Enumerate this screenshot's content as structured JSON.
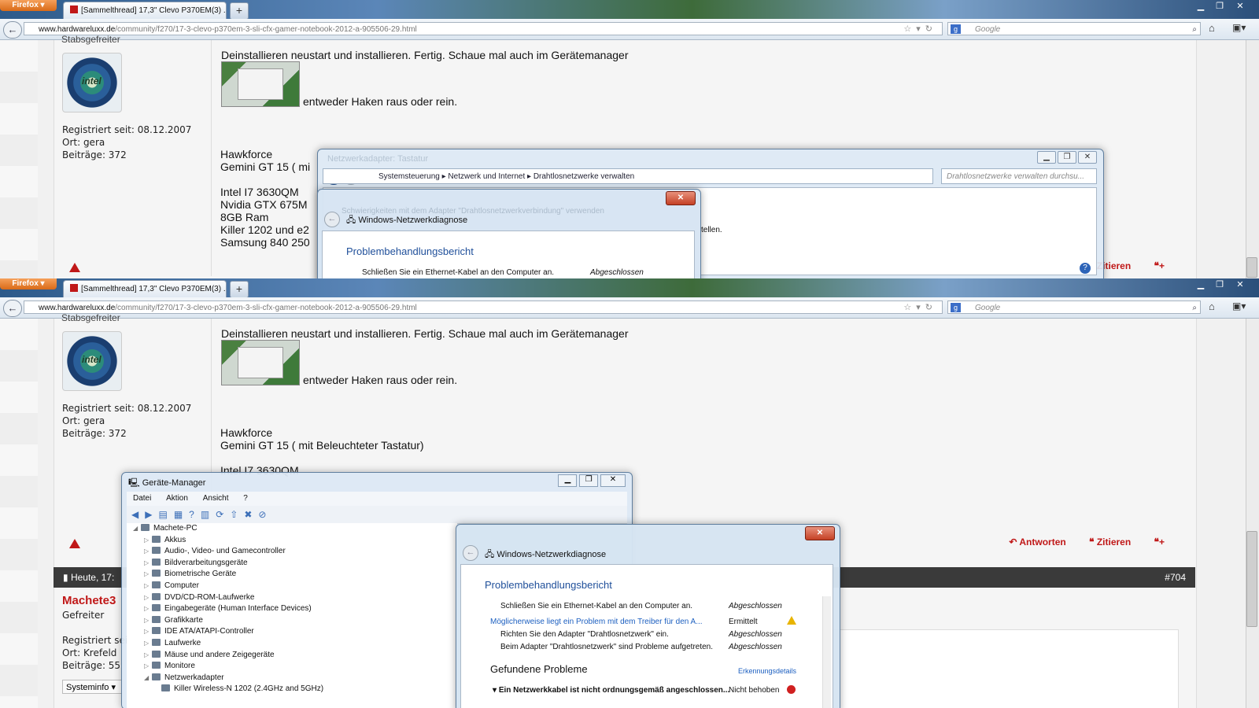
{
  "browser": {
    "menu_button": "Firefox",
    "tab_title": "[Sammelthread] 17,3\" Clevo P370EM(3) ...",
    "newtab": "+",
    "url_domain": "www.hardwareluxx.de",
    "url_path": "/community/f270/17-3-clevo-p370em-3-sli-cfx-gamer-notebook-2012-a-905506-29.html",
    "search_placeholder": "Google"
  },
  "post1": {
    "rank": "Stabsgefreiter",
    "avatar_text": "intel",
    "registered": "Registriert seit: 08.12.2007",
    "location": "Ort: gera",
    "posts": "Beiträge: 372",
    "text_line1": "Deinstallieren neustart und installieren. Fertig. Schaue mal auch im Gerätemanager",
    "text_line2": "entweder Haken raus oder rein.",
    "sig_name": "Hawkforce",
    "sig_laptop_short": "Gemini GT 15 ( mi",
    "sig_laptop": "Gemini GT 15 ( mit Beleuchteter Tastatur)",
    "sig_cpu": "Intel I7 3630QM",
    "sig_gpu": "Nvidia GTX 675M",
    "sig_ram": "8GB Ram",
    "sig_wifi": "Killer 1202 und e2",
    "sig_ssd": "Samsung 840 250",
    "sig_ssd_full": "Samsung 840 250",
    "action_reply": "Antworten",
    "action_quote": "Zitieren"
  },
  "explorer": {
    "crumb1": "Systemsteuerung",
    "crumb2": "Netzwerk und Internet",
    "crumb3": "Drahtlosnetzwerke verwalten",
    "search": "Drahtlosnetzwerke verwalten durchsu...",
    "faded_title": "Netzwerkadapter: Tastatur",
    "faded_line": "Schwierigkeiten mit dem Adapter \"Drahtlosnetzwerkverbindung\" verwenden",
    "partial_text": "tellen."
  },
  "diagnostic": {
    "title": "Windows-Netzwerkdiagnose",
    "report_heading": "Problembehandlungsbericht",
    "rows": [
      {
        "text": "Schließen Sie ein Ethernet-Kabel an den Computer an.",
        "status": "Abgeschlossen"
      },
      {
        "text": "Möglicherweise liegt ein Problem mit dem Treiber für den A...",
        "status": "Ermittelt"
      },
      {
        "text": "Richten Sie den Adapter \"Drahtlosnetzwerk\" ein.",
        "status": "Abgeschlossen"
      },
      {
        "text": "Beim Adapter \"Drahtlosnetzwerk\" sind Probleme aufgetreten.",
        "status": "Abgeschlossen"
      }
    ],
    "found_heading": "Gefundene Probleme",
    "details_link": "Erkennungsdetails",
    "found_row": "Ein Netzwerkkabel ist nicht ordnungsgemäß angeschlossen...",
    "found_status": "Nicht behoben"
  },
  "devmgr": {
    "title": "Geräte-Manager",
    "menu": [
      "Datei",
      "Aktion",
      "Ansicht",
      "?"
    ],
    "root": "Machete-PC",
    "items": [
      "Akkus",
      "Audio-, Video- und Gamecontroller",
      "Bildverarbeitungsgeräte",
      "Biometrische Geräte",
      "Computer",
      "DVD/CD-ROM-Laufwerke",
      "Eingabegeräte (Human Interface Devices)",
      "Grafikkarte",
      "IDE ATA/ATAPI-Controller",
      "Laufwerke",
      "Mäuse und andere Zeigegeräte",
      "Monitore",
      "Netzwerkadapter"
    ],
    "child": "Killer Wireless-N 1202 (2.4GHz and 5GHz)"
  },
  "post2": {
    "thread_date": "Heute, 17:",
    "post_number": "#704",
    "username": "Machete3",
    "rank": "Gefreiter",
    "registered": "Registriert sei",
    "location": "Ort: Krefeld",
    "posts": "Beiträge: 55",
    "sysinfo": "Systeminfo"
  }
}
